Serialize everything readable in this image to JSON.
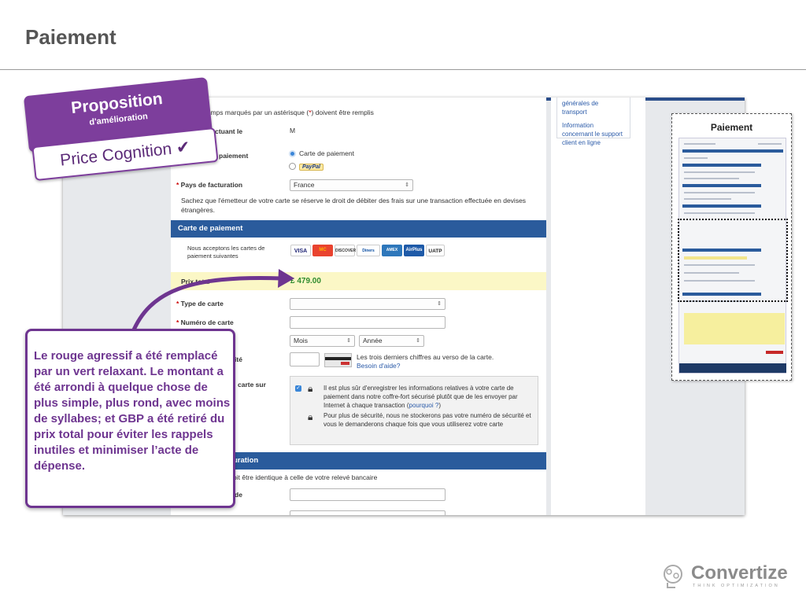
{
  "slide": {
    "title": "Paiement"
  },
  "screenshot": {
    "required_note": "hamps marqués par un astérisque (",
    "required_note_star": "*",
    "required_note_end": ") doivent être remplis",
    "payer_label": "effectuant le",
    "payer_value": "M",
    "payment_method_label": "paiement",
    "payment_option_card": "Carte de paiement",
    "payment_option_paypal": "PayPal",
    "billing_country_label": "Pays de facturation",
    "billing_country_value": "France",
    "fees_note": "Sachez que l'émetteur de votre carte se réserve le droit de débiter des frais sur une transaction effectuée en devises étrangères.",
    "card_section_title": "Carte de paiement",
    "accepted_cards_text": "Nous acceptons les cartes de paiement suivantes",
    "card_logos": [
      "VISA",
      "MC",
      "DISCOVER",
      "Diners",
      "AMEX",
      "AirPlus",
      "UATP"
    ],
    "total_label": "Prix total",
    "total_value": "£ 479.00",
    "card_type_label": "Type de carte",
    "card_number_label": "Numéro de carte",
    "month_placeholder": "Mois",
    "year_placeholder": "Année",
    "security_code_label": "ité",
    "cvv_help": "Les trois derniers chiffres au verso de la carte.",
    "help_link": "Besoin d'aide?",
    "save_card_label": "carte sur",
    "save_card_text": "Il est plus sûr d'enregistrer les informations relatives à votre carte de paiement dans notre coffre-fort sécurisé plutôt que de les envoyer par Internet à chaque transaction (",
    "why_link": "pourquoi ?",
    "save_card_text_end": ")",
    "security_text": "Pour plus de sécurité, nous ne stockerons pas votre numéro de sécurité et vous le demanderons chaque fois que vous utiliserez votre carte",
    "billing_section_title": "uration",
    "billing_note": "oit être identique à celle de votre relevé bancaire",
    "billing_field_label": "de",
    "sidebar_link_1": "générales de transport",
    "sidebar_link_2": "Information concernant le support client en ligne"
  },
  "badges": {
    "proposition": "Proposition",
    "proposition_sub": "d'amélioration",
    "price_cognition": "Price Cognition ✔"
  },
  "callout": {
    "text": "Le rouge agressif a été remplacé par un vert relaxant. Le montant a été arrondi à quelque chose de plus simple, plus rond, avec moins de syllabes; et GBP a été retiré du prix total pour éviter les rappels inutiles et minimiser l’acte de dépense."
  },
  "thumbnail": {
    "title": "Paiement"
  },
  "logo": {
    "brand": "Convertize",
    "tagline": "THINK OPTIMIZATION"
  },
  "colors": {
    "accent_purple": "#7d3e9c",
    "section_blue": "#2a5b9c",
    "total_green": "#2e8b2e",
    "total_bg": "#fbf7c6"
  }
}
